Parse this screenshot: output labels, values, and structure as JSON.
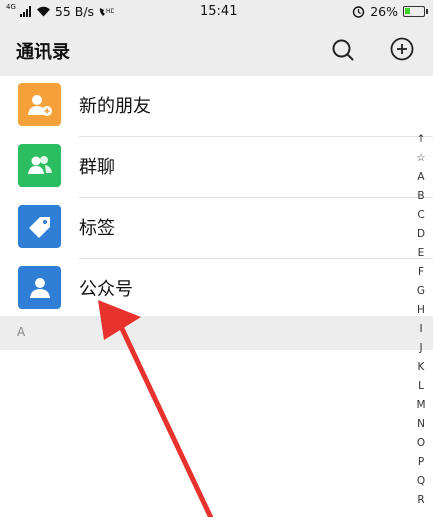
{
  "status_bar": {
    "network_type": "4G",
    "speed": "55 B/s",
    "time": "15:41",
    "battery": "26%",
    "battery_level": 0.26
  },
  "header": {
    "title": "通讯录"
  },
  "items": [
    {
      "label": "新的朋友",
      "icon": "add-friend-icon",
      "color": "#f5a13a"
    },
    {
      "label": "群聊",
      "icon": "group-chat-icon",
      "color": "#2bbd5f"
    },
    {
      "label": "标签",
      "icon": "tag-icon",
      "color": "#2f7fd6"
    },
    {
      "label": "公众号",
      "icon": "official-account-icon",
      "color": "#2f7fd6"
    }
  ],
  "section": {
    "label": "A"
  },
  "index_bar": [
    "↑",
    "☆",
    "A",
    "B",
    "C",
    "D",
    "E",
    "F",
    "G",
    "H",
    "I",
    "J",
    "K",
    "L",
    "M",
    "N",
    "O",
    "P",
    "Q",
    "R"
  ],
  "colors": {
    "annotation_arrow": "#e8322d",
    "header_bg": "#ededed"
  }
}
